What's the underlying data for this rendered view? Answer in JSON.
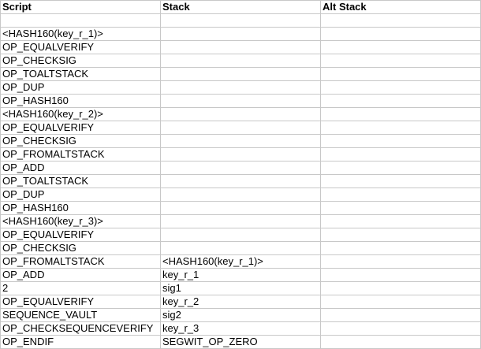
{
  "headers": {
    "script": "Script",
    "stack": "Stack",
    "alt_stack": "Alt Stack"
  },
  "rows": [
    {
      "script": "",
      "stack": "",
      "alt": ""
    },
    {
      "script": "<HASH160(key_r_1)>",
      "stack": "",
      "alt": ""
    },
    {
      "script": "OP_EQUALVERIFY",
      "stack": "",
      "alt": ""
    },
    {
      "script": "OP_CHECKSIG",
      "stack": "",
      "alt": ""
    },
    {
      "script": "OP_TOALTSTACK",
      "stack": "",
      "alt": ""
    },
    {
      "script": "OP_DUP",
      "stack": "",
      "alt": ""
    },
    {
      "script": "OP_HASH160",
      "stack": "",
      "alt": ""
    },
    {
      "script": "<HASH160(key_r_2)>",
      "stack": "",
      "alt": ""
    },
    {
      "script": "OP_EQUALVERIFY",
      "stack": "",
      "alt": ""
    },
    {
      "script": "OP_CHECKSIG",
      "stack": "",
      "alt": ""
    },
    {
      "script": "OP_FROMALTSTACK",
      "stack": "",
      "alt": ""
    },
    {
      "script": "OP_ADD",
      "stack": "",
      "alt": ""
    },
    {
      "script": "OP_TOALTSTACK",
      "stack": "",
      "alt": ""
    },
    {
      "script": "OP_DUP",
      "stack": "",
      "alt": ""
    },
    {
      "script": "OP_HASH160",
      "stack": "",
      "alt": ""
    },
    {
      "script": "<HASH160(key_r_3)>",
      "stack": "",
      "alt": ""
    },
    {
      "script": "OP_EQUALVERIFY",
      "stack": "",
      "alt": ""
    },
    {
      "script": "OP_CHECKSIG",
      "stack": "",
      "alt": ""
    },
    {
      "script": "OP_FROMALTSTACK",
      "stack": "<HASH160(key_r_1)>",
      "alt": ""
    },
    {
      "script": "OP_ADD",
      "stack": "key_r_1",
      "alt": ""
    },
    {
      "script": "2",
      "stack": "sig1",
      "alt": ""
    },
    {
      "script": "OP_EQUALVERIFY",
      "stack": "key_r_2",
      "alt": ""
    },
    {
      "script": "SEQUENCE_VAULT",
      "stack": "sig2",
      "alt": ""
    },
    {
      "script": "OP_CHECKSEQUENCEVERIFY",
      "stack": "key_r_3",
      "alt": ""
    },
    {
      "script": "OP_ENDIF",
      "stack": "SEGWIT_OP_ZERO",
      "alt": ""
    }
  ]
}
